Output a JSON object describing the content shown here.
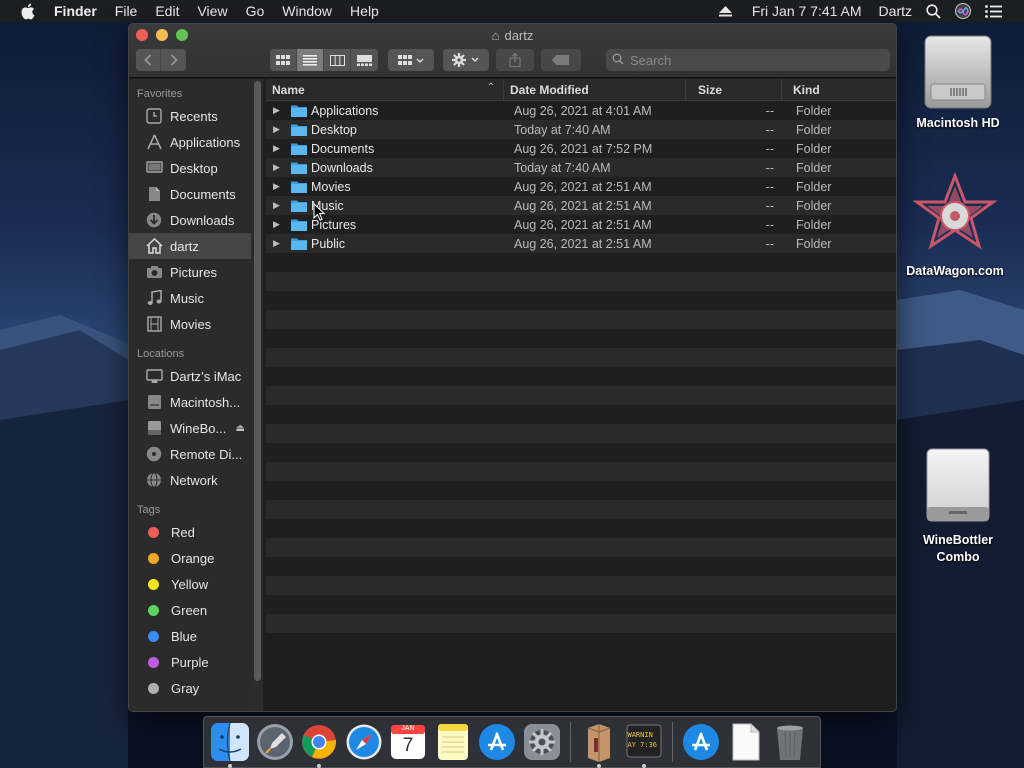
{
  "menubar": {
    "app_name": "Finder",
    "menus": [
      "File",
      "Edit",
      "View",
      "Go",
      "Window",
      "Help"
    ],
    "datetime": "Fri Jan 7  7:41 AM",
    "user": "Dartz"
  },
  "window": {
    "title": "dartz",
    "search_placeholder": "Search"
  },
  "sidebar": {
    "favorites_header": "Favorites",
    "favorites": [
      {
        "label": "Recents",
        "icon": "clock-icon"
      },
      {
        "label": "Applications",
        "icon": "applications-icon"
      },
      {
        "label": "Desktop",
        "icon": "desktop-icon"
      },
      {
        "label": "Documents",
        "icon": "document-icon"
      },
      {
        "label": "Downloads",
        "icon": "download-icon"
      },
      {
        "label": "dartz",
        "icon": "home-icon",
        "selected": true
      },
      {
        "label": "Pictures",
        "icon": "camera-icon"
      },
      {
        "label": "Music",
        "icon": "music-note-icon"
      },
      {
        "label": "Movies",
        "icon": "film-icon"
      }
    ],
    "locations_header": "Locations",
    "locations": [
      {
        "label": "Dartz’s iMac",
        "icon": "imac-icon"
      },
      {
        "label": "Macintosh...",
        "icon": "hard-drive-icon"
      },
      {
        "label": "WineBo...",
        "icon": "disk-image-icon",
        "eject": true
      },
      {
        "label": "Remote Di...",
        "icon": "optical-disc-icon"
      },
      {
        "label": "Network",
        "icon": "globe-icon"
      }
    ],
    "tags_header": "Tags",
    "tags": [
      {
        "label": "Red",
        "color": "#ec5f57"
      },
      {
        "label": "Orange",
        "color": "#f5a623"
      },
      {
        "label": "Yellow",
        "color": "#f8e71c"
      },
      {
        "label": "Green",
        "color": "#5fd35f"
      },
      {
        "label": "Blue",
        "color": "#3b8bf5"
      },
      {
        "label": "Purple",
        "color": "#c05ae0"
      },
      {
        "label": "Gray",
        "color": "#b0b0b0"
      }
    ]
  },
  "columns": {
    "name": "Name",
    "date_modified": "Date Modified",
    "size": "Size",
    "kind": "Kind"
  },
  "files": [
    {
      "name": "Applications",
      "date": "Aug 26, 2021 at 4:01 AM",
      "size": "--",
      "kind": "Folder"
    },
    {
      "name": "Desktop",
      "date": "Today at 7:40 AM",
      "size": "--",
      "kind": "Folder"
    },
    {
      "name": "Documents",
      "date": "Aug 26, 2021 at 7:52 PM",
      "size": "--",
      "kind": "Folder"
    },
    {
      "name": "Downloads",
      "date": "Today at 7:40 AM",
      "size": "--",
      "kind": "Folder"
    },
    {
      "name": "Movies",
      "date": "Aug 26, 2021 at 2:51 AM",
      "size": "--",
      "kind": "Folder"
    },
    {
      "name": "Music",
      "date": "Aug 26, 2021 at 2:51 AM",
      "size": "--",
      "kind": "Folder"
    },
    {
      "name": "Pictures",
      "date": "Aug 26, 2021 at 2:51 AM",
      "size": "--",
      "kind": "Folder"
    },
    {
      "name": "Public",
      "date": "Aug 26, 2021 at 2:51 AM",
      "size": "--",
      "kind": "Folder"
    }
  ],
  "desktop_icons": {
    "hd": "Macintosh HD",
    "datawagon": "DataWagon.com",
    "winebottler_line1": "WineBottler",
    "winebottler_line2": "Combo"
  },
  "dock": {
    "calendar_month": "JAN",
    "calendar_day": "7",
    "console_line1": "WARNIN",
    "console_line2": "AY 7:36"
  }
}
